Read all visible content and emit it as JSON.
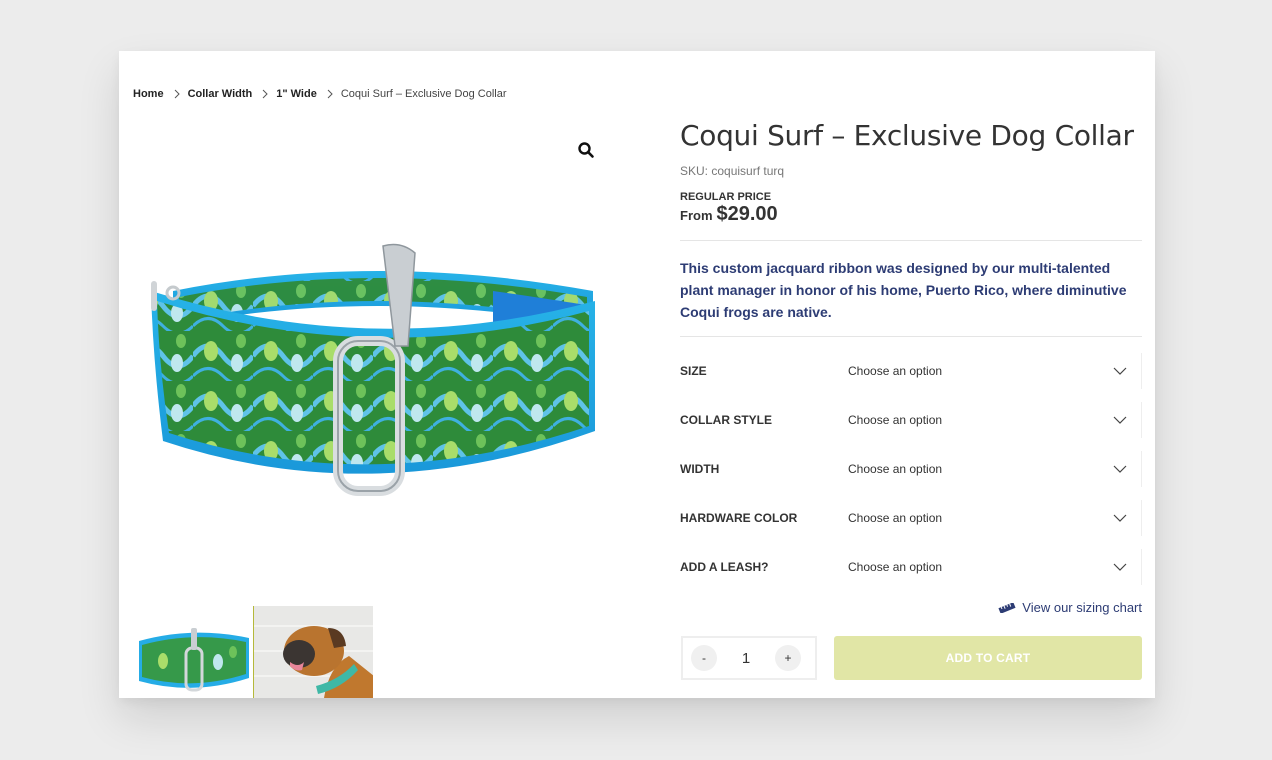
{
  "breadcrumb": [
    {
      "label": "Home"
    },
    {
      "label": "Collar Width"
    },
    {
      "label": "1\" Wide"
    },
    {
      "label": "Coqui Surf – Exclusive Dog Collar"
    }
  ],
  "product": {
    "title": "Coqui Surf – Exclusive Dog Collar",
    "sku": "SKU: coquisurf turq",
    "price_label": "REGULAR PRICE",
    "price_prefix": "From",
    "price": "$29.00",
    "description": "This custom jacquard ribbon was designed by our multi-talented plant manager in honor of his home, Puerto Rico, where diminutive Coqui frogs are native."
  },
  "gallery": {
    "zoom_icon": "search-icon",
    "main_image_alt": "Coqui Surf turquoise martingale collar with green frog pattern",
    "thumbnails": [
      {
        "alt": "Collar thumbnail"
      },
      {
        "alt": "Boxer dog wearing collar"
      }
    ]
  },
  "variations": [
    {
      "label": "SIZE",
      "value": "Choose an option"
    },
    {
      "label": "COLLAR STYLE",
      "value": "Choose an option"
    },
    {
      "label": "WIDTH",
      "value": "Choose an option"
    },
    {
      "label": "HARDWARE COLOR",
      "value": "Choose an option"
    },
    {
      "label": "ADD A LEASH?",
      "value": "Choose an option"
    }
  ],
  "sizing_chart": {
    "label": "View our sizing chart",
    "icon": "ruler-icon"
  },
  "cart": {
    "minus": "-",
    "plus": "+",
    "quantity": "1",
    "add_label": "ADD TO CART"
  },
  "colors": {
    "accent_text": "#2d3c74",
    "add_to_cart_bg": "#e1e6a6",
    "collar_blue": "#1aa3e8",
    "collar_green": "#2e8b3a"
  }
}
